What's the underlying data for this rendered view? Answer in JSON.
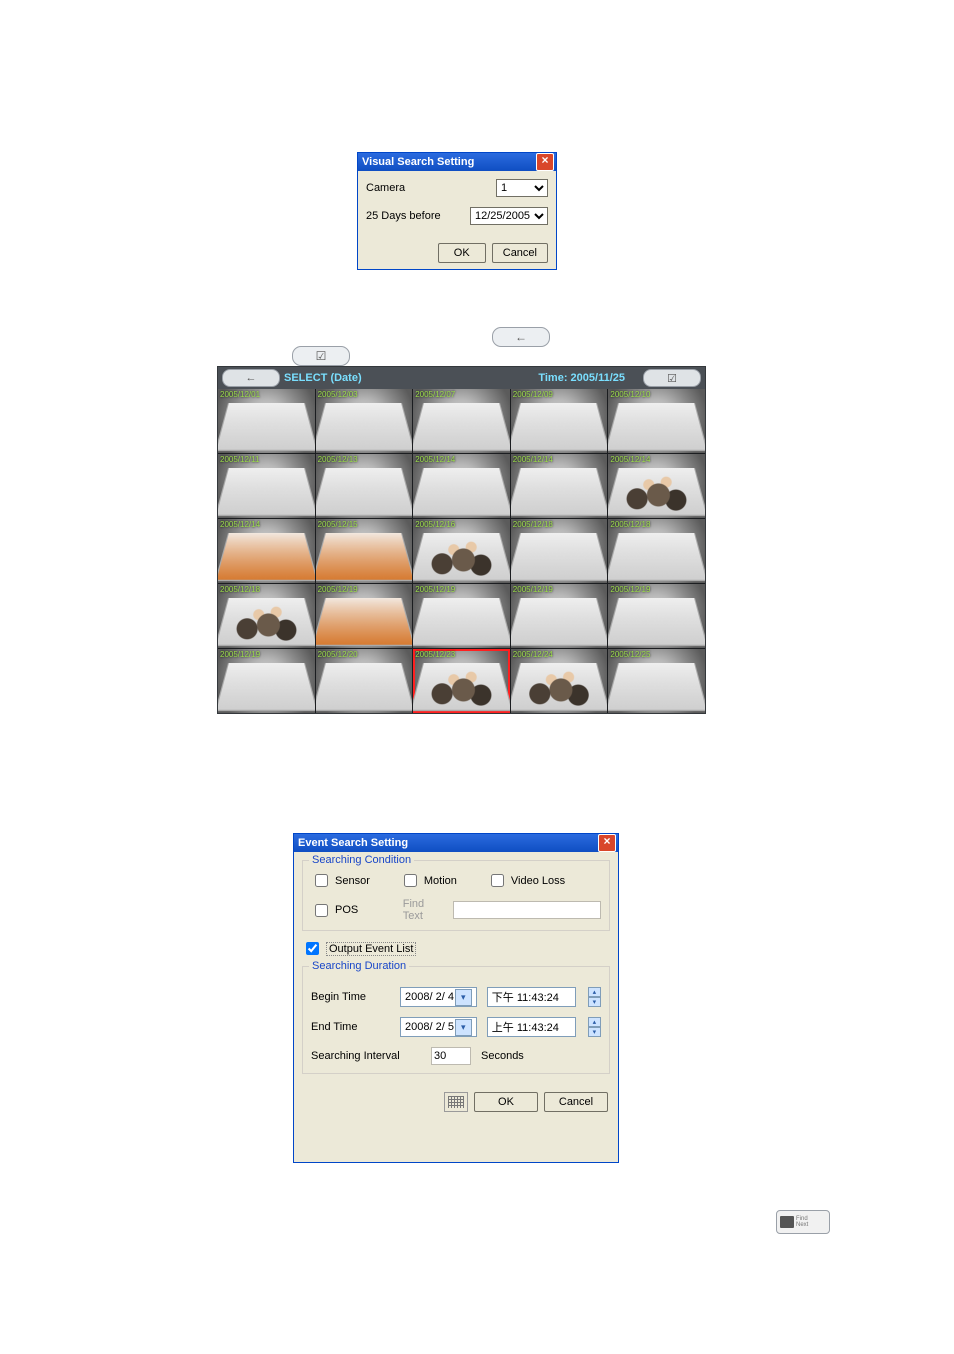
{
  "visual_search": {
    "title": "Visual Search Setting",
    "camera_label": "Camera",
    "camera_value": "1",
    "days_label": "25 Days before",
    "date_value": "12/25/2005",
    "ok": "OK",
    "cancel": "Cancel"
  },
  "grid": {
    "select_label": "SELECT (Date)",
    "time_label": "Time: 2005/11/25",
    "rows": [
      [
        {
          "ts": "2005/12/01",
          "people": false,
          "orange": false,
          "selected": false
        },
        {
          "ts": "2005/12/03",
          "people": false,
          "orange": false,
          "selected": false
        },
        {
          "ts": "2005/12/07",
          "people": false,
          "orange": false,
          "selected": false
        },
        {
          "ts": "2005/12/09",
          "people": false,
          "orange": false,
          "selected": false
        },
        {
          "ts": "2005/12/10",
          "people": false,
          "orange": false,
          "selected": false
        }
      ],
      [
        {
          "ts": "2005/12/11",
          "people": false,
          "orange": false,
          "selected": false
        },
        {
          "ts": "2005/12/13",
          "people": false,
          "orange": false,
          "selected": false
        },
        {
          "ts": "2005/12/14",
          "people": false,
          "orange": false,
          "selected": false
        },
        {
          "ts": "2005/12/14",
          "people": false,
          "orange": false,
          "selected": false
        },
        {
          "ts": "2005/12/14",
          "people": true,
          "orange": false,
          "selected": false
        }
      ],
      [
        {
          "ts": "2005/12/14",
          "people": false,
          "orange": true,
          "selected": false
        },
        {
          "ts": "2005/12/15",
          "people": false,
          "orange": true,
          "selected": false
        },
        {
          "ts": "2005/12/16",
          "people": true,
          "orange": false,
          "selected": false
        },
        {
          "ts": "2005/12/18",
          "people": false,
          "orange": false,
          "selected": false
        },
        {
          "ts": "2005/12/18",
          "people": false,
          "orange": false,
          "selected": false
        }
      ],
      [
        {
          "ts": "2005/12/18",
          "people": true,
          "orange": false,
          "selected": false
        },
        {
          "ts": "2005/12/19",
          "people": false,
          "orange": true,
          "selected": false
        },
        {
          "ts": "2005/12/19",
          "people": false,
          "orange": false,
          "selected": false
        },
        {
          "ts": "2005/12/19",
          "people": false,
          "orange": false,
          "selected": false
        },
        {
          "ts": "2005/12/19",
          "people": false,
          "orange": false,
          "selected": false
        }
      ],
      [
        {
          "ts": "2005/12/19",
          "people": false,
          "orange": false,
          "selected": false
        },
        {
          "ts": "2005/12/20",
          "people": false,
          "orange": false,
          "selected": false
        },
        {
          "ts": "2005/12/23",
          "people": true,
          "orange": false,
          "selected": true
        },
        {
          "ts": "2005/12/24",
          "people": true,
          "orange": false,
          "selected": false
        },
        {
          "ts": "2005/12/25",
          "people": false,
          "orange": false,
          "selected": false
        }
      ]
    ]
  },
  "event_search": {
    "title": "Event Search Setting",
    "cond_title": "Searching Condition",
    "sensor": "Sensor",
    "motion": "Motion",
    "video_loss": "Video Loss",
    "pos": "POS",
    "find_text_label": "Find Text",
    "find_text_value": "",
    "output_evt": "Output Event List",
    "output_evt_checked": true,
    "dur_title": "Searching Duration",
    "begin_label": "Begin Time",
    "begin_date": "2008/ 2/ 4",
    "begin_time": "下午 11:43:24",
    "end_label": "End Time",
    "end_date": "2008/ 2/ 5",
    "end_time": "上午 11:43:24",
    "interval_label": "Searching Interval",
    "interval_value": "30",
    "interval_unit": "Seconds",
    "ok": "OK",
    "cancel": "Cancel"
  },
  "findnext": {
    "line1": "Find",
    "line2": "Next"
  }
}
